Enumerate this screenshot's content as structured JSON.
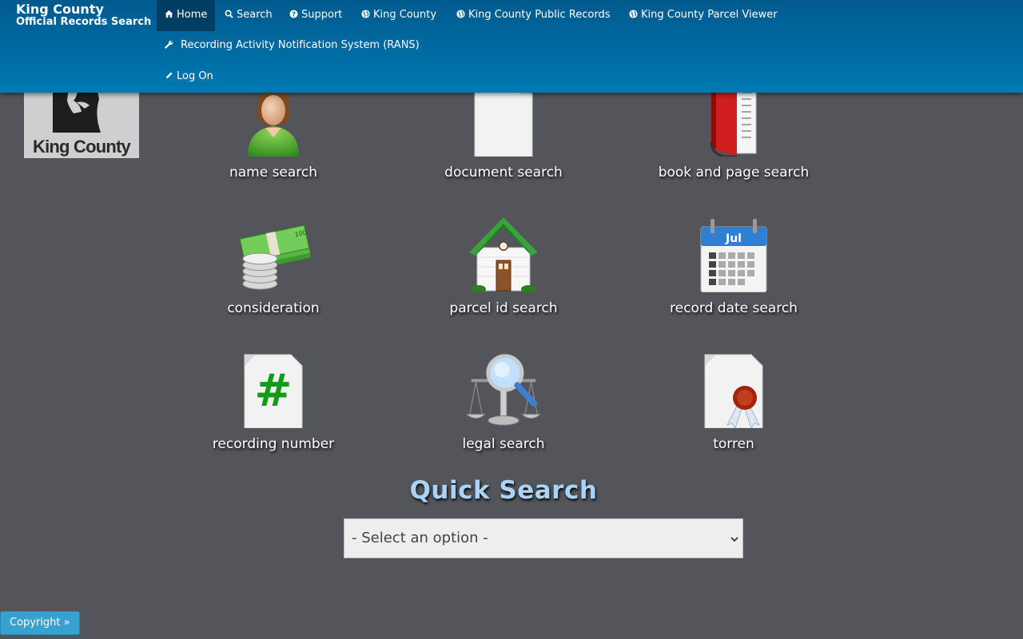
{
  "brand": {
    "line1": "King County",
    "line2": "Official Records Search"
  },
  "nav": {
    "home": "Home",
    "search": "Search",
    "support": "Support",
    "king_county": "King County",
    "public_records": "King County Public Records",
    "parcel_viewer": "King County Parcel Viewer",
    "rans": "Recording Activity Notification System (RANS)",
    "log_on": "Log On"
  },
  "logo": {
    "text": "King County"
  },
  "tiles": [
    {
      "label": "name search",
      "icon": "person-icon"
    },
    {
      "label": "document search",
      "icon": "document-icon"
    },
    {
      "label": "book and page search",
      "icon": "book-icon"
    },
    {
      "label": "consideration",
      "icon": "money-icon"
    },
    {
      "label": "parcel id search",
      "icon": "house-icon"
    },
    {
      "label": "record date search",
      "icon": "calendar-icon"
    },
    {
      "label": "recording number",
      "icon": "hash-document-icon"
    },
    {
      "label": "legal search",
      "icon": "scales-magnifier-icon"
    },
    {
      "label": "torren",
      "icon": "sealed-document-icon"
    }
  ],
  "calendar_month": "Jul",
  "quick_search": {
    "title": "Quick Search",
    "selected": "- Select an option -"
  },
  "copyright": "Copyright »",
  "colors": {
    "navbar": "#0079b3",
    "active_nav": "#003f63",
    "background": "#53555a",
    "quick_search_title": "#a9d3f7",
    "copyright_button": "#37a2cf"
  }
}
